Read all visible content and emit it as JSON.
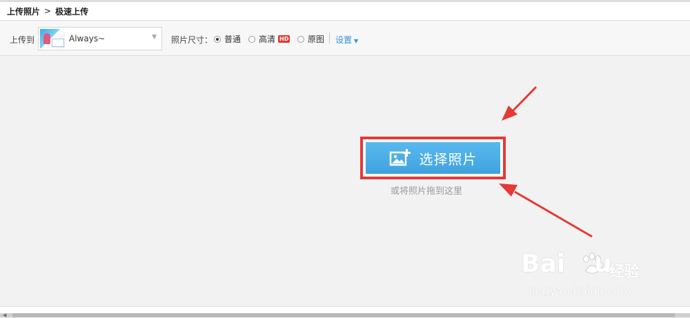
{
  "breadcrumb": {
    "root": "上传照片",
    "separator": ">",
    "current": "极速上传"
  },
  "toolbar": {
    "upload_to_label": "上传到",
    "album": {
      "name": "Always~",
      "thumb_icon": "album-cover-thumbnail"
    },
    "size_label": "照片尺寸：",
    "options": [
      {
        "label": "普通",
        "checked": true
      },
      {
        "label": "高清",
        "badge": "HD",
        "checked": false
      },
      {
        "label": "原图",
        "checked": false
      }
    ],
    "settings_label": "设置"
  },
  "main": {
    "select_button_label": "选择照片",
    "select_icon": "add-photo-icon",
    "drop_hint": "或将照片拖到这里"
  },
  "watermark": {
    "brand": "Bai",
    "brand_tail": "u",
    "cn": "经验",
    "url": "jingyan.baidu.com"
  },
  "colors": {
    "accent_blue": "#3fa3e0",
    "highlight_red": "#e53935",
    "link_blue": "#3a8fd6",
    "hd_red": "#e5382f"
  }
}
